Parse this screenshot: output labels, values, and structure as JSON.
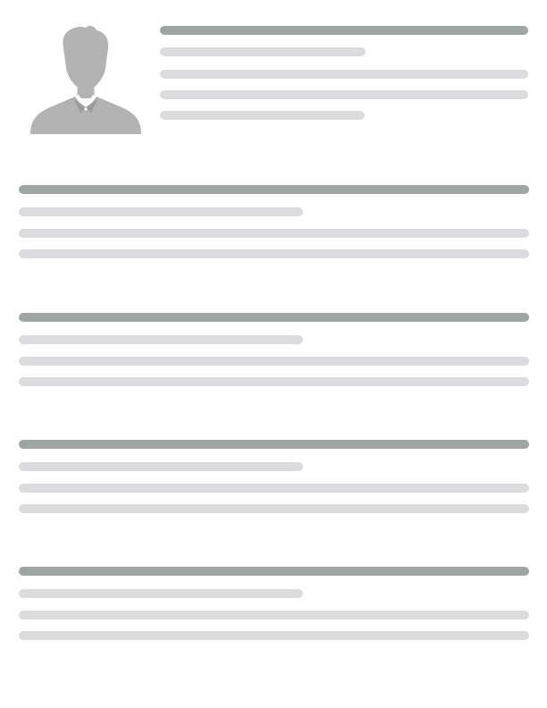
{
  "colors": {
    "header_line": "#9ea5a3",
    "body_line": "#dcdcdf",
    "avatar": "#b3b3b3",
    "background": "#ffffff"
  },
  "avatar": {
    "icon": "person-silhouette-icon"
  },
  "sections": [
    {
      "name": "section-1"
    },
    {
      "name": "section-2"
    },
    {
      "name": "section-3"
    },
    {
      "name": "section-4"
    }
  ]
}
